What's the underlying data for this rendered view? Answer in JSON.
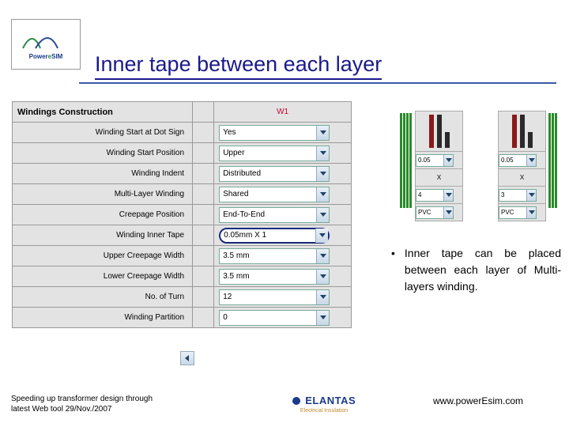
{
  "title": "Inner tape between each layer",
  "logo_text": "Power eSIM",
  "table": {
    "header": "Windings Construction",
    "col_w1": "W1",
    "rows": [
      {
        "label": "Winding Start at Dot Sign",
        "value": "Yes"
      },
      {
        "label": "Winding Start Position",
        "value": "Upper"
      },
      {
        "label": "Winding Indent",
        "value": "Distributed"
      },
      {
        "label": "Multi-Layer Winding",
        "value": "Shared"
      },
      {
        "label": "Creepage Position",
        "value": "End-To-End"
      },
      {
        "label": "Winding Inner Tape",
        "value": "0.05mm X 1"
      },
      {
        "label": "Upper Creepage Width",
        "value": "3.5 mm"
      },
      {
        "label": "Lower Creepage Width",
        "value": "3.5 mm"
      },
      {
        "label": "No. of Turn",
        "value": "12"
      },
      {
        "label": "Winding Partition",
        "value": "0"
      }
    ]
  },
  "mini1": {
    "r1": "0.05",
    "r2": "X",
    "r3": "4",
    "r4": "PVC"
  },
  "mini2": {
    "r1": "0.05",
    "r2": "X",
    "r3": "3",
    "r4": "PVC"
  },
  "bullet": "Inner tape can be placed between each layer of Multi-layers winding.",
  "footer_left_1": "Speeding up transformer design through",
  "footer_left_2": "latest Web tool                    29/Nov./2007",
  "footer_mid": "ELANTAS",
  "footer_mid_sub": "Electrical Insulation",
  "footer_right": "www.powerEsim.com"
}
